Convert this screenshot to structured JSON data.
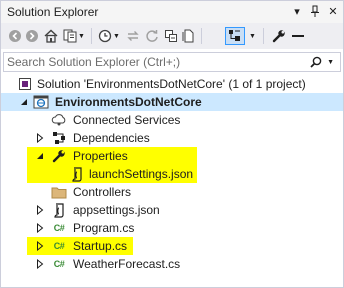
{
  "window": {
    "title": "Solution Explorer",
    "buttons": [
      "▾",
      "⊥",
      "✕"
    ]
  },
  "toolbar": {
    "buttons": [
      {
        "name": "back-button",
        "icon": "back-arrow-icon"
      },
      {
        "name": "forward-button",
        "icon": "forward-arrow-icon"
      },
      {
        "name": "home-button",
        "icon": "home-icon"
      },
      {
        "name": "switch-views-button",
        "icon": "switch-views-icon"
      },
      {
        "name": "pending-changes-filter-button",
        "icon": "clock-icon"
      },
      {
        "name": "sync-with-active-document-button",
        "icon": "sync-icon"
      },
      {
        "name": "refresh-button",
        "icon": "refresh-icon"
      },
      {
        "name": "collapse-all-button",
        "icon": "collapse-all-icon"
      },
      {
        "name": "show-all-files-button",
        "icon": "show-all-files-icon"
      },
      {
        "name": "preview-selected-items-button",
        "icon": "preview-icon",
        "selected": true
      },
      {
        "name": "properties-button",
        "icon": "wrench-icon"
      },
      {
        "name": "pin-toolbar-button",
        "icon": "dash-icon"
      }
    ]
  },
  "search": {
    "placeholder": "Search Solution Explorer (Ctrl+;)",
    "value": ""
  },
  "tree": {
    "solution": "Solution 'EnvironmentsDotNetCore' (1 of 1 project)",
    "project": "EnvironmentsDotNetCore",
    "items": [
      {
        "label": "Connected Services",
        "icon": "connected-services-icon",
        "highlight": false
      },
      {
        "label": "Dependencies",
        "icon": "dependencies-icon",
        "highlight": false
      },
      {
        "label": "Properties",
        "icon": "wrench-icon",
        "highlight": true
      },
      {
        "label": "launchSettings.json",
        "icon": "json-file-icon",
        "highlight": true
      },
      {
        "label": "Controllers",
        "icon": "folder-icon",
        "highlight": false
      },
      {
        "label": "appsettings.json",
        "icon": "json-file-icon",
        "highlight": false
      },
      {
        "label": "Program.cs",
        "icon": "csharp-file-icon",
        "highlight": false
      },
      {
        "label": "Startup.cs",
        "icon": "csharp-file-icon",
        "highlight": true
      },
      {
        "label": "WeatherForecast.cs",
        "icon": "csharp-file-icon",
        "highlight": false
      }
    ],
    "csharp_glyph": "C#"
  },
  "colors": {
    "highlight": "#ffff00",
    "selected_row": "#cce8ff",
    "toolbar_bg": "#eeeef2",
    "folder": "#dcb67a",
    "csharp": "#388a34",
    "accent_blue": "#3399ff"
  }
}
